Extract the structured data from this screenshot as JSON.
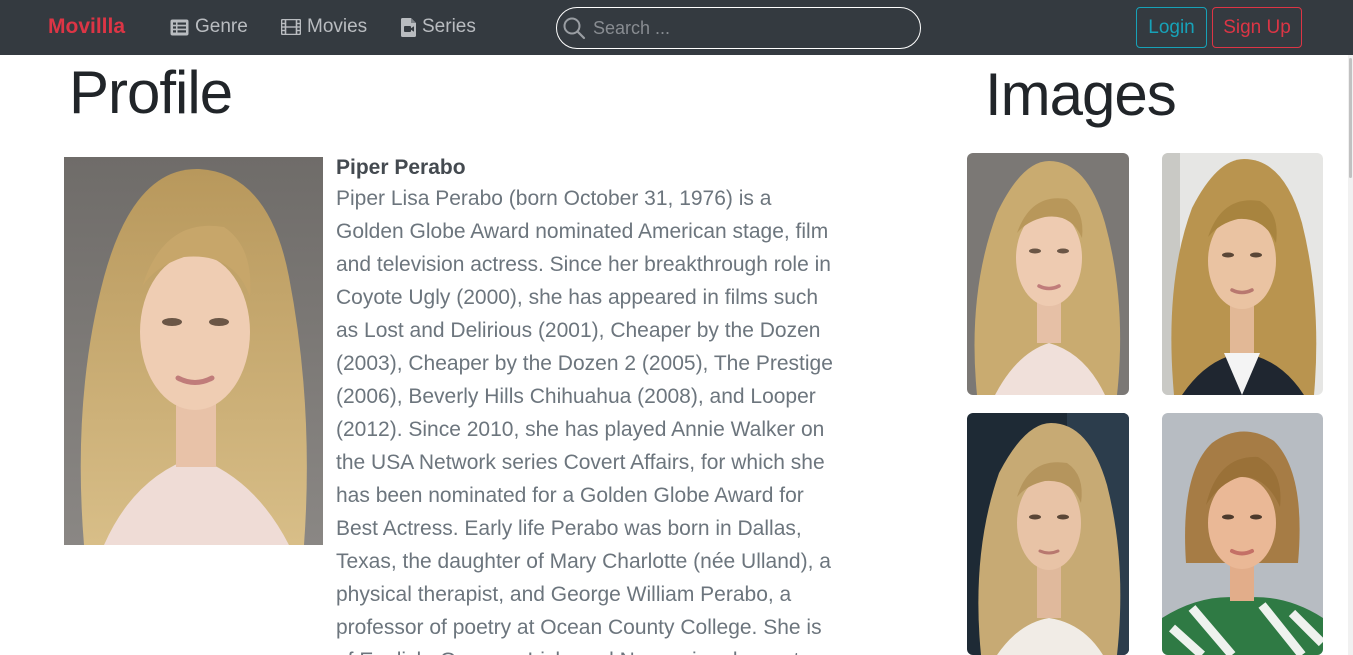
{
  "navbar": {
    "brand": "Movillla",
    "links": [
      {
        "label": "Genre",
        "icon": "list-icon"
      },
      {
        "label": "Movies",
        "icon": "film-icon"
      },
      {
        "label": "Series",
        "icon": "tv-file-icon"
      }
    ],
    "search": {
      "placeholder": "Search ...",
      "value": ""
    },
    "login_label": "Login",
    "signup_label": "Sign Up"
  },
  "profile": {
    "heading": "Profile",
    "name": "Piper Perabo",
    "bio": "Piper Lisa Perabo (born October 31, 1976) is a Golden Globe Award nominated American stage, film and television actress. Since her breakthrough role in Coyote Ugly (2000), she has appeared in films such as Lost and Delirious (2001), Cheaper by the Dozen (2003), Cheaper by the Dozen 2 (2005), The Prestige (2006), Beverly Hills Chihuahua (2008), and Looper (2012). Since 2010, she has played Annie Walker on the USA Network series Covert Affairs, for which she has been nominated for a Golden Globe Award for Best Actress. Early life Perabo was born in Dallas, Texas, the daughter of Mary Charlotte (née Ulland), a physical therapist, and George William Perabo, a professor of poetry at Ocean County College. She is of English, German, Irish, and Norwegian descent."
  },
  "images": {
    "heading": "Images",
    "items": [
      {
        "alt": "portrait-white-top"
      },
      {
        "alt": "portrait-white-shirt"
      },
      {
        "alt": "portrait-dark-background"
      },
      {
        "alt": "portrait-green-print-top"
      }
    ]
  },
  "colors": {
    "navbar_bg": "#343a40",
    "brand": "#dc3545",
    "login": "#17a2b8",
    "signup": "#dc3545"
  }
}
